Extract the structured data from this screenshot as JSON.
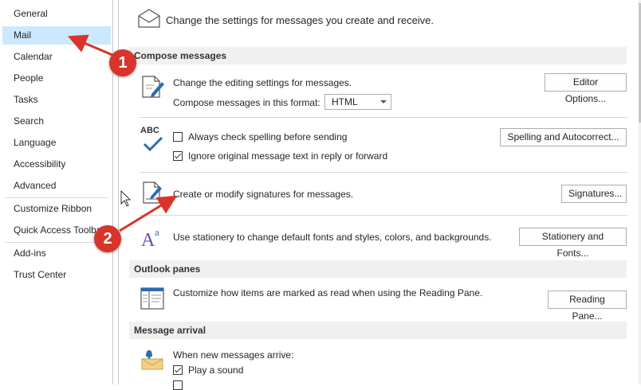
{
  "sidebar": {
    "items": [
      {
        "label": "General"
      },
      {
        "label": "Mail",
        "selected": true
      },
      {
        "label": "Calendar"
      },
      {
        "label": "People"
      },
      {
        "label": "Tasks"
      },
      {
        "label": "Search"
      },
      {
        "label": "Language"
      },
      {
        "label": "Accessibility"
      },
      {
        "label": "Advanced"
      },
      {
        "label": "Customize Ribbon"
      },
      {
        "label": "Quick Access Toolbar"
      },
      {
        "label": "Add-ins"
      },
      {
        "label": "Trust Center"
      }
    ]
  },
  "main": {
    "intro": "Change the settings for messages you create and receive.",
    "compose": {
      "header": "Compose messages",
      "editing_text": "Change the editing settings for messages.",
      "editor_options_button": "Editor Options...",
      "format_label": "Compose messages in this format:",
      "format_value": "HTML",
      "spelling_check_label": "Always check spelling before sending",
      "spelling_check_checked": false,
      "ignore_original_label": "Ignore original message text in reply or forward",
      "ignore_original_checked": true,
      "spelling_button": "Spelling and Autocorrect...",
      "abc_text": "ABC",
      "signatures_text": "Create or modify signatures for messages.",
      "signatures_button": "Signatures...",
      "stationery_text": "Use stationery to change default fonts and styles, colors, and backgrounds.",
      "stationery_button": "Stationery and Fonts..."
    },
    "panes": {
      "header": "Outlook panes",
      "reading_text": "Customize how items are marked as read when using the Reading Pane.",
      "reading_button": "Reading Pane..."
    },
    "arrival": {
      "header": "Message arrival",
      "when_text": "When new messages arrive:",
      "play_sound_label": "Play a sound",
      "play_sound_checked": true
    }
  },
  "annotations": {
    "badge1": "1",
    "badge2": "2"
  },
  "colors": {
    "selected_bg": "#cce8ff",
    "accent_blue": "#2b6cb0",
    "badge_red": "#d9342b",
    "arrow_red": "#d9342b"
  }
}
